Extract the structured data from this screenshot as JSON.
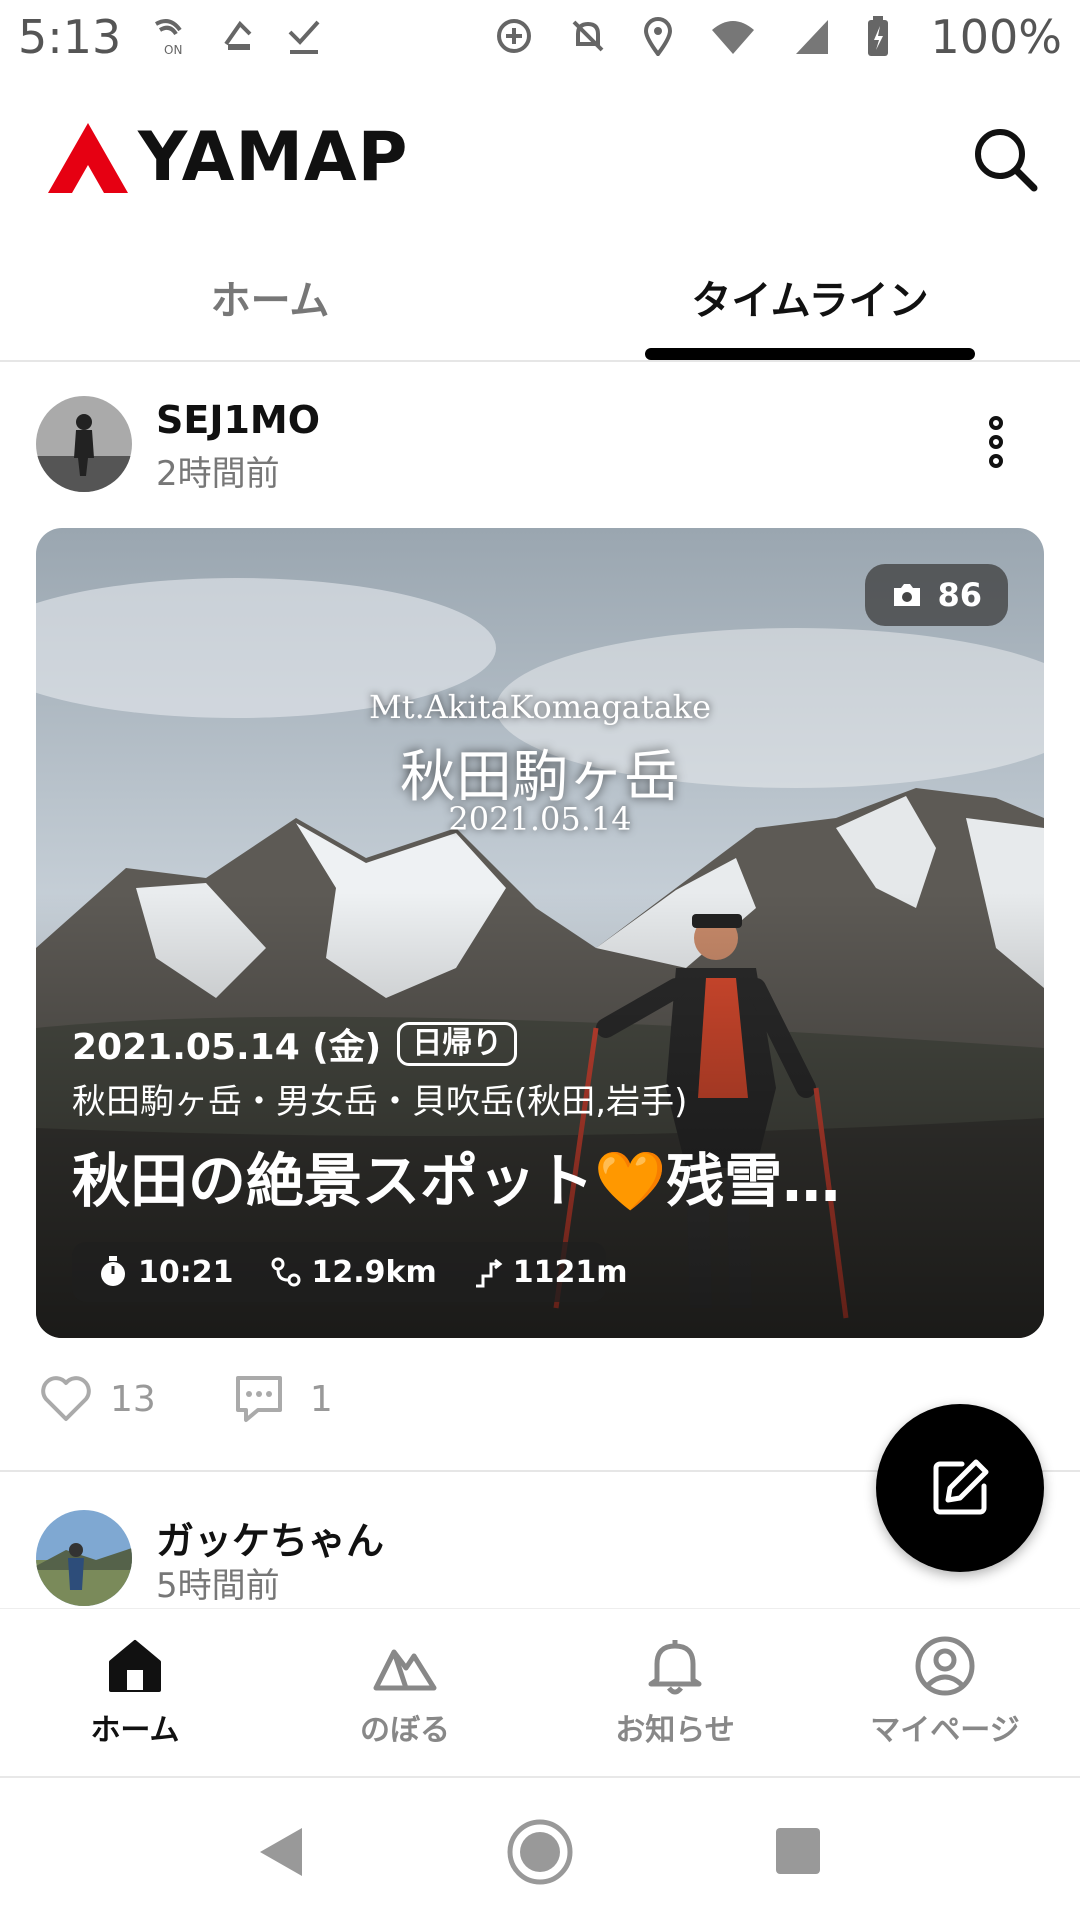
{
  "status_bar": {
    "time": "5:13",
    "battery": "100%"
  },
  "header": {
    "logo_text": "YAMAP"
  },
  "tabs": [
    {
      "label": "ホーム",
      "active": false
    },
    {
      "label": "タイムライン",
      "active": true
    }
  ],
  "post1": {
    "username": "SEJ1MO",
    "time_ago": "2時間前",
    "photo_count": "86",
    "overlay_en": "Mt.AkitaKomagatake",
    "overlay_jp": "秋田駒ヶ岳",
    "overlay_date": "2021.05.14",
    "date": "2021.05.14 (金)",
    "trip_type": "日帰り",
    "mountains": "秋田駒ヶ岳・男女岳・貝吹岳(秋田,岩手)",
    "title": "秋田の絶景スポット🧡残雪…",
    "stats": {
      "duration": "10:21",
      "distance": "12.9km",
      "elevation": "1121m"
    },
    "likes": "13",
    "comments": "1"
  },
  "post2": {
    "username": "ガッケちゃん",
    "time_ago": "5時間前"
  },
  "bottom_nav": [
    {
      "label": "ホーム",
      "icon": "home-icon",
      "active": true
    },
    {
      "label": "のぼる",
      "icon": "mountain-icon",
      "active": false
    },
    {
      "label": "お知らせ",
      "icon": "bell-icon",
      "active": false
    },
    {
      "label": "マイページ",
      "icon": "user-circle-icon",
      "active": false
    }
  ],
  "colors": {
    "brand_red": "#e60012",
    "active_tab": "#000000"
  }
}
